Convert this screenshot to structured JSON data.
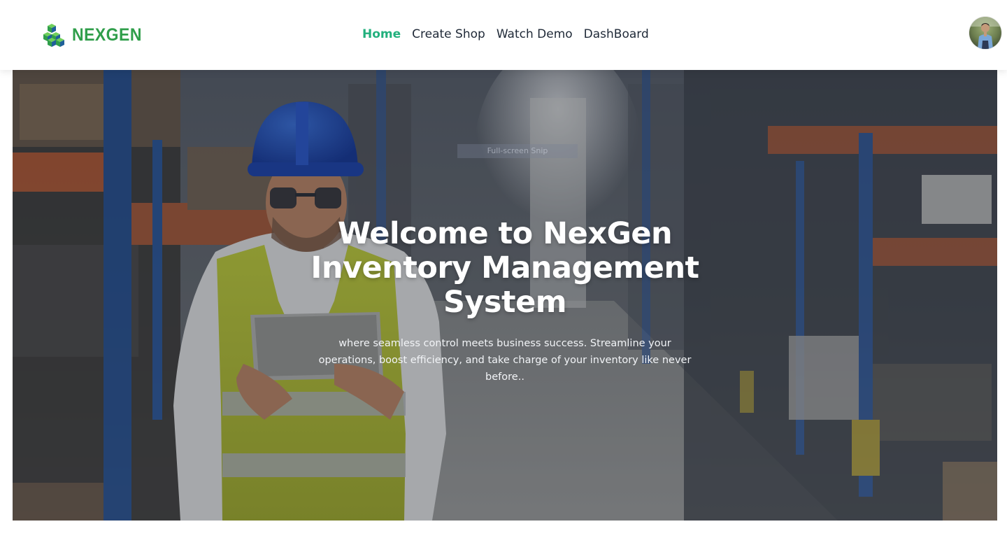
{
  "brand": {
    "name": "NEXGEN",
    "logo_icon": "cubes-icon",
    "color": "#2f9e4a"
  },
  "nav": {
    "items": [
      {
        "label": "Home",
        "active": true
      },
      {
        "label": "Create Shop",
        "active": false
      },
      {
        "label": "Watch Demo",
        "active": false
      },
      {
        "label": "DashBoard",
        "active": false
      }
    ],
    "active_color": "#22b07d",
    "text_color": "#1f2937"
  },
  "user": {
    "avatar_icon": "user-avatar-icon"
  },
  "hero": {
    "title": "Welcome to NexGen Inventory Management System",
    "subtitle": "where seamless control meets business success. Streamline your operations, boost efficiency, and take charge of your inventory like never before..",
    "overlay_label": "Full-screen Snip",
    "background": "warehouse-worker-photo"
  }
}
